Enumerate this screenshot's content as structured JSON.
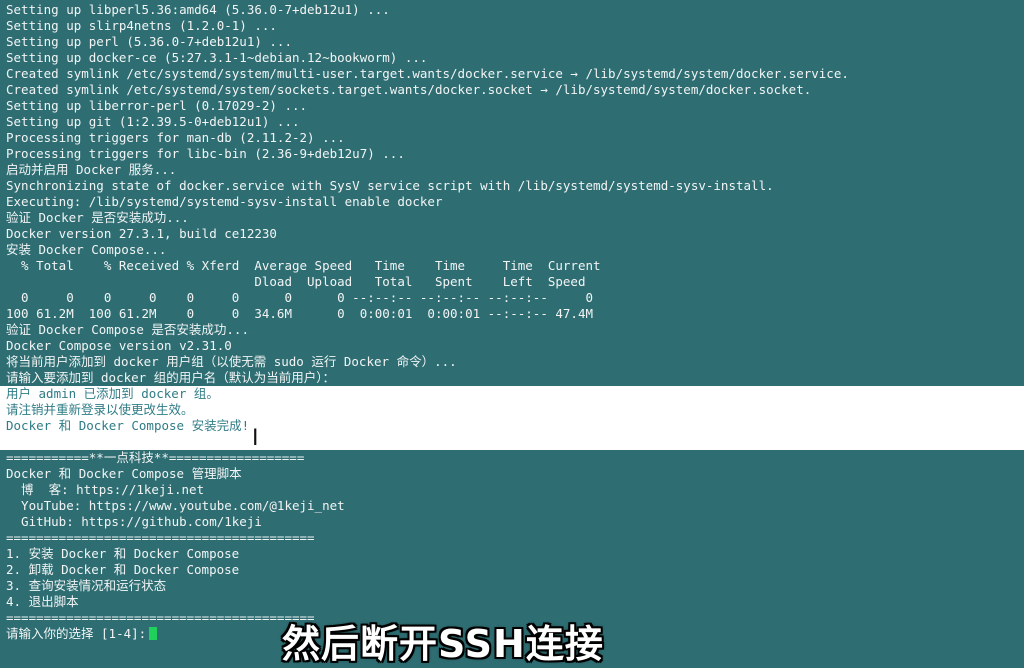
{
  "terminal": {
    "lines": [
      "Setting up libperl5.36:amd64 (5.36.0-7+deb12u1) ...",
      "Setting up slirp4netns (1.2.0-1) ...",
      "Setting up perl (5.36.0-7+deb12u1) ...",
      "Setting up docker-ce (5:27.3.1-1~debian.12~bookworm) ...",
      "Created symlink /etc/systemd/system/multi-user.target.wants/docker.service → /lib/systemd/system/docker.service.",
      "Created symlink /etc/systemd/system/sockets.target.wants/docker.socket → /lib/systemd/system/docker.socket.",
      "Setting up liberror-perl (0.17029-2) ...",
      "Setting up git (1:2.39.5-0+deb12u1) ...",
      "Processing triggers for man-db (2.11.2-2) ...",
      "Processing triggers for libc-bin (2.36-9+deb12u7) ...",
      "启动并启用 Docker 服务...",
      "Synchronizing state of docker.service with SysV service script with /lib/systemd/systemd-sysv-install.",
      "Executing: /lib/systemd/systemd-sysv-install enable docker",
      "验证 Docker 是否安装成功...",
      "Docker version 27.3.1, build ce12230",
      "安装 Docker Compose...",
      "  % Total    % Received % Xferd  Average Speed   Time    Time     Time  Current",
      "                                 Dload  Upload   Total   Spent    Left  Speed",
      "",
      "  0     0    0     0    0     0      0      0 --:--:-- --:--:-- --:--:--     0",
      "100 61.2M  100 61.2M    0     0  34.6M      0  0:00:01  0:00:01 --:--:-- 47.4M",
      "验证 Docker Compose 是否安装成功...",
      "Docker Compose version v2.31.0",
      "将当前用户添加到 docker 用户组（以使无需 sudo 运行 Docker 命令）...",
      "请输入要添加到 docker 组的用户名（默认为当前用户）："
    ],
    "highlighted_lines": [
      "用户 admin 已添加到 docker 组。",
      "请注销并重新登录以使更改生效。",
      "Docker 和 Docker Compose 安装完成!"
    ],
    "menu_lines": [
      "===========**一点科技**==================",
      "Docker 和 Docker Compose 管理脚本",
      "  博  客: https://1keji.net",
      "  YouTube: https://www.youtube.com/@1keji_net",
      "  GitHub: https://github.com/1keji",
      "=========================================",
      "1. 安装 Docker 和 Docker Compose",
      "2. 卸载 Docker 和 Docker Compose",
      "3. 查询安装情况和运行状态",
      "4. 退出脚本",
      "========================================="
    ],
    "prompt": "请输入你的选择 [1-4]:"
  },
  "subtitle": "然后断开SSH连接",
  "colors": {
    "background": "#2e6e73",
    "text": "#f2f4f4",
    "highlight_text": "#2f7c86",
    "cursor": "#1fd05a"
  }
}
